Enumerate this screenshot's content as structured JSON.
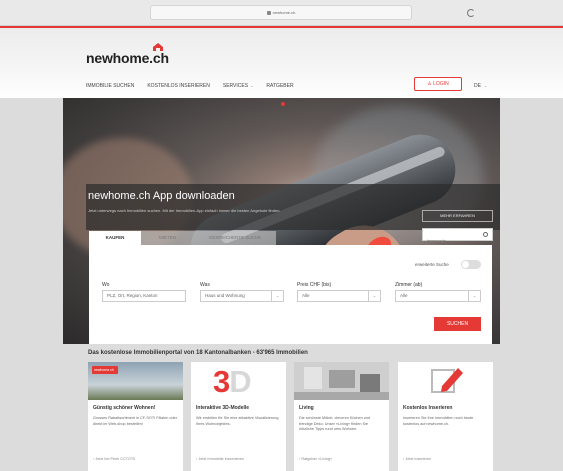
{
  "browser": {
    "url": "newhome.ch"
  },
  "header": {
    "logo": "newhome.ch",
    "nav": [
      {
        "label": "IMMOBILIE SUCHEN",
        "has_dropdown": false
      },
      {
        "label": "KOSTENLOS INSERIEREN",
        "has_dropdown": false
      },
      {
        "label": "SERVICES",
        "has_dropdown": true
      },
      {
        "label": "RATGEBER",
        "has_dropdown": false
      }
    ],
    "login_label": "LOGIN",
    "language": "DE"
  },
  "promo": {
    "title": "newhome.ch App downloaden",
    "subtitle": "Jetzt unterwegs nach Immobilien suchen. Mit der Immobilien-App einfach immer die besten Angebote finden.",
    "more_label": "MEHR ERFAHREN"
  },
  "search": {
    "tabs": [
      {
        "label": "KAUFEN",
        "active": true
      },
      {
        "label": "MIETEN",
        "active": false
      },
      {
        "label": "GESPEICHERTE SUCHE",
        "active": false
      }
    ],
    "id_placeholder": "Immocode",
    "advanced_label": "erweiterte Suche",
    "fields": [
      {
        "label": "Wo",
        "value": "PLZ, Ort, Region, Kanton"
      },
      {
        "label": "Was",
        "value": "Haus und Wohnung"
      },
      {
        "label": "Preis CHF (bis)",
        "value": "Alle"
      },
      {
        "label": "Zimmer (ab)",
        "value": "Alle"
      }
    ],
    "submit_label": "SUCHEN"
  },
  "section": {
    "title": "Das kostenlose Immobilienportal von 18 Kantonalbanken - 63'965 Immobilien",
    "cards": [
      {
        "title": "Günstig schöner Wohnen!",
        "text": "Grosses Rabattsortiment in CF-SOTI Filialen oder direkt im Web-shop bestellen!",
        "link": "Jetzt bei Peek CCTOTII",
        "badge": "newhome.ch"
      },
      {
        "title": "Interaktive 3D-Modelle",
        "text": "Wir erstellen für Sie eine attraktive Visualisierung Ihres Wohnobjektes.",
        "link": "Jetzt Immobilie inszenieren"
      },
      {
        "title": "Living",
        "text": "Die schönste Möbel, cleveren Küchen und trendige Deko: Unser «Living» finden Sie nützliche Tipps rund ums Wohnen.",
        "link": "Ratgeber «Living»"
      },
      {
        "title": "Kostenlos Inserieren",
        "text": "Inserieren Sie Ihre Immobilien noch heute kostenlos auf newhome.ch.",
        "link": "Jetzt inserieren"
      }
    ]
  },
  "colors": {
    "accent": "#e53935",
    "hero_overlay": "#2d2d2d"
  }
}
